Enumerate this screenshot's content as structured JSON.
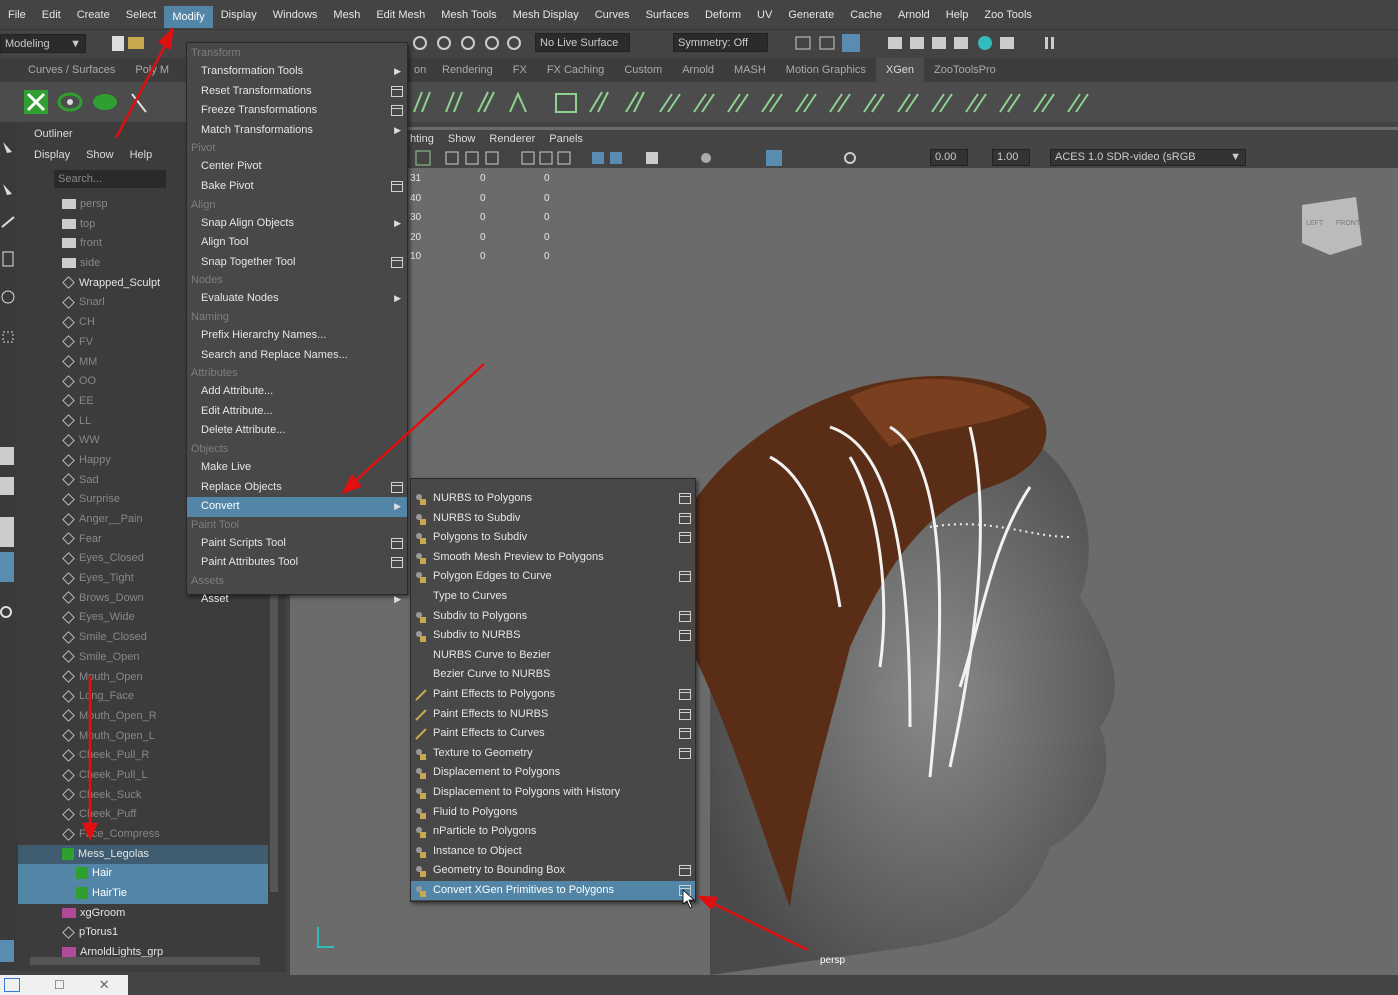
{
  "menubar": [
    "File",
    "Edit",
    "Create",
    "Select",
    "Modify",
    "Display",
    "Windows",
    "Mesh",
    "Edit Mesh",
    "Mesh Tools",
    "Mesh Display",
    "Curves",
    "Surfaces",
    "Deform",
    "UV",
    "Generate",
    "Cache",
    "Arnold",
    "Help",
    "Zoo Tools"
  ],
  "status": {
    "mode": "Modeling",
    "live_surface": "No Live Surface",
    "symmetry": "Symmetry: Off"
  },
  "shelf_tabs": [
    "Curves / Surfaces",
    "Poly M",
    "Rendering",
    "FX",
    "FX Caching",
    "Custom",
    "Arnold",
    "MASH",
    "Motion Graphics",
    "XGen",
    "ZooToolsPro"
  ],
  "shelf_tabs_partial": [
    "on"
  ],
  "outliner": {
    "title": "Outliner",
    "menu": [
      "Display",
      "Show",
      "Help"
    ],
    "search_placeholder": "Search...",
    "items": [
      {
        "label": "persp",
        "dim": true,
        "type": "cam"
      },
      {
        "label": "top",
        "dim": true,
        "type": "cam"
      },
      {
        "label": "front",
        "dim": true,
        "type": "cam"
      },
      {
        "label": "side",
        "dim": true,
        "type": "cam"
      },
      {
        "label": "Wrapped_Sculpt",
        "dim": false,
        "type": "mesh"
      },
      {
        "label": "Snarl",
        "dim": true,
        "type": "mesh"
      },
      {
        "label": "CH",
        "dim": true,
        "type": "mesh"
      },
      {
        "label": "FV",
        "dim": true,
        "type": "mesh"
      },
      {
        "label": "MM",
        "dim": true,
        "type": "mesh"
      },
      {
        "label": "OO",
        "dim": true,
        "type": "mesh"
      },
      {
        "label": "EE",
        "dim": true,
        "type": "mesh"
      },
      {
        "label": "LL",
        "dim": true,
        "type": "mesh"
      },
      {
        "label": "WW",
        "dim": true,
        "type": "mesh"
      },
      {
        "label": "Happy",
        "dim": true,
        "type": "mesh"
      },
      {
        "label": "Sad",
        "dim": true,
        "type": "mesh"
      },
      {
        "label": "Surprise",
        "dim": true,
        "type": "mesh"
      },
      {
        "label": "Anger__Pain",
        "dim": true,
        "type": "mesh"
      },
      {
        "label": "Fear",
        "dim": true,
        "type": "mesh"
      },
      {
        "label": "Eyes_Closed",
        "dim": true,
        "type": "mesh"
      },
      {
        "label": "Eyes_Tight",
        "dim": true,
        "type": "mesh"
      },
      {
        "label": "Brows_Down",
        "dim": true,
        "type": "mesh"
      },
      {
        "label": "Eyes_Wide",
        "dim": true,
        "type": "mesh"
      },
      {
        "label": "Smile_Closed",
        "dim": true,
        "type": "mesh"
      },
      {
        "label": "Smile_Open",
        "dim": true,
        "type": "mesh"
      },
      {
        "label": "Mouth_Open",
        "dim": true,
        "type": "mesh"
      },
      {
        "label": "Long_Face",
        "dim": true,
        "type": "mesh"
      },
      {
        "label": "Mouth_Open_R",
        "dim": true,
        "type": "mesh"
      },
      {
        "label": "Mouth_Open_L",
        "dim": true,
        "type": "mesh"
      },
      {
        "label": "Cheek_Pull_R",
        "dim": true,
        "type": "mesh"
      },
      {
        "label": "Cheek_Pull_L",
        "dim": true,
        "type": "mesh"
      },
      {
        "label": "Cheek_Suck",
        "dim": true,
        "type": "mesh"
      },
      {
        "label": "Cheek_Puff",
        "dim": true,
        "type": "mesh"
      },
      {
        "label": "Face_Compress",
        "dim": true,
        "type": "mesh"
      },
      {
        "label": "Mess_Legolas",
        "dim": false,
        "type": "xgen",
        "sel": "light"
      },
      {
        "label": "Hair",
        "dim": false,
        "type": "xgen",
        "sel": "strong",
        "indent": true
      },
      {
        "label": "HairTie",
        "dim": false,
        "type": "xgen",
        "sel": "strong",
        "indent": true
      },
      {
        "label": "xgGroom",
        "dim": false,
        "type": "groom"
      },
      {
        "label": "pTorus1",
        "dim": false,
        "type": "mesh"
      },
      {
        "label": "ArnoldLights_grp",
        "dim": false,
        "type": "groom"
      }
    ]
  },
  "viewport": {
    "menu": [
      "hting",
      "Show",
      "Renderer",
      "Panels"
    ],
    "val1": "0.00",
    "val2": "1.00",
    "colorspace": "ACES 1.0 SDR-video (sRGB",
    "hud_rows": [
      [
        "31",
        "0",
        "0"
      ],
      [
        "40",
        "0",
        "0"
      ],
      [
        "30",
        "0",
        "0"
      ],
      [
        "20",
        "0",
        "0"
      ],
      [
        "10",
        "0",
        "0"
      ]
    ],
    "camera": "persp",
    "viewcube": [
      "LEFT",
      "FRONT"
    ]
  },
  "modify_menu": [
    {
      "section": "Transform"
    },
    {
      "label": "Transformation Tools",
      "sub": true
    },
    {
      "label": "Reset Transformations",
      "opt": true
    },
    {
      "label": "Freeze Transformations",
      "opt": true
    },
    {
      "label": "Match Transformations",
      "sub": true
    },
    {
      "section": "Pivot"
    },
    {
      "label": "Center Pivot"
    },
    {
      "label": "Bake Pivot",
      "opt": true
    },
    {
      "section": "Align"
    },
    {
      "label": "Snap Align Objects",
      "sub": true
    },
    {
      "label": "Align Tool"
    },
    {
      "label": "Snap Together Tool",
      "opt": true
    },
    {
      "section": "Nodes"
    },
    {
      "label": "Evaluate Nodes",
      "sub": true
    },
    {
      "section": "Naming"
    },
    {
      "label": "Prefix Hierarchy Names..."
    },
    {
      "label": "Search and Replace Names..."
    },
    {
      "section": "Attributes"
    },
    {
      "label": "Add Attribute..."
    },
    {
      "label": "Edit Attribute..."
    },
    {
      "label": "Delete Attribute..."
    },
    {
      "section": "Objects"
    },
    {
      "label": "Make Live"
    },
    {
      "label": "Replace Objects",
      "opt": true
    },
    {
      "label": "Convert",
      "sub": true,
      "hl": true
    },
    {
      "section": "Paint Tool"
    },
    {
      "label": "Paint Scripts Tool",
      "opt": true
    },
    {
      "label": "Paint Attributes Tool",
      "opt": true
    },
    {
      "section": "Assets"
    },
    {
      "label": "Asset",
      "sub": true
    }
  ],
  "convert_menu": [
    {
      "label": "NURBS to Polygons",
      "opt": true
    },
    {
      "label": "NURBS to Subdiv",
      "opt": true
    },
    {
      "label": "Polygons to Subdiv",
      "opt": true
    },
    {
      "label": "Smooth Mesh Preview to Polygons"
    },
    {
      "label": "Polygon Edges to Curve",
      "opt": true
    },
    {
      "label": "Type to Curves",
      "noicon": true
    },
    {
      "label": "Subdiv to Polygons",
      "opt": true
    },
    {
      "label": "Subdiv to NURBS",
      "opt": true
    },
    {
      "label": "NURBS Curve to Bezier",
      "noicon": true
    },
    {
      "label": "Bezier Curve to NURBS",
      "noicon": true
    },
    {
      "label": "Paint Effects to Polygons",
      "opt": true,
      "brush": true
    },
    {
      "label": "Paint Effects to NURBS",
      "opt": true,
      "brush": true
    },
    {
      "label": "Paint Effects to Curves",
      "opt": true,
      "brush": true
    },
    {
      "label": "Texture to Geometry",
      "opt": true
    },
    {
      "label": "Displacement to Polygons"
    },
    {
      "label": "Displacement to Polygons with History"
    },
    {
      "label": "Fluid to Polygons"
    },
    {
      "label": "nParticle to Polygons"
    },
    {
      "label": "Instance to Object"
    },
    {
      "label": "Geometry to Bounding Box",
      "opt": true
    },
    {
      "label": "Convert XGen Primitives to Polygons",
      "opt": true,
      "hl": true
    }
  ],
  "colors": {
    "accent": "#5285a6",
    "arrow": "#e01010",
    "xgen": "#2fa02f"
  }
}
